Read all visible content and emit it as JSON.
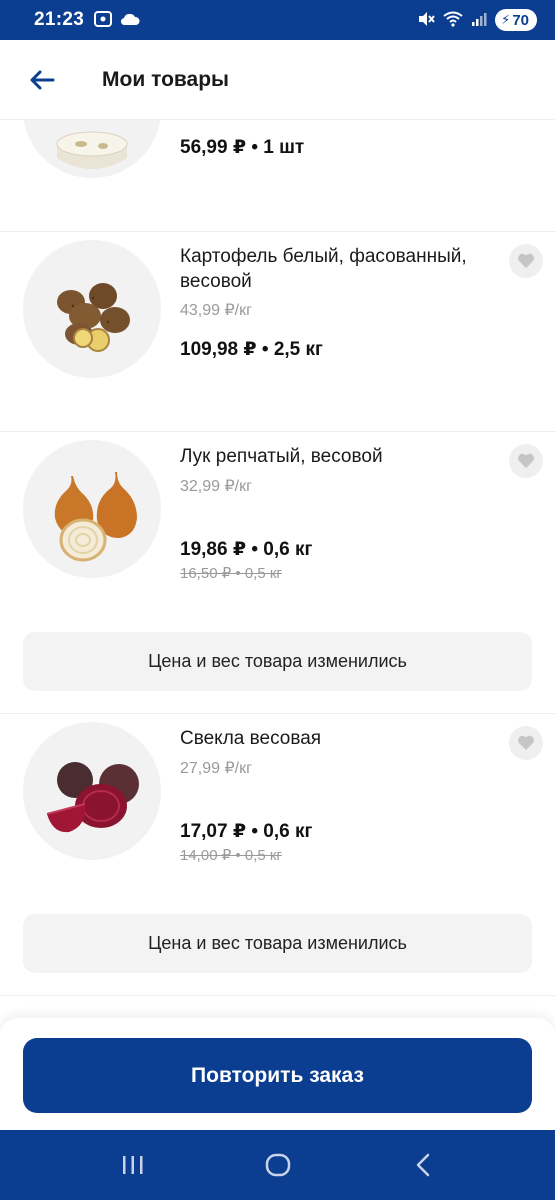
{
  "status_bar": {
    "time": "21:23",
    "battery": "70",
    "icons": [
      "screenshot-icon",
      "cloud-icon",
      "mute-icon",
      "wifi-icon",
      "signal-icon",
      "battery-icon"
    ]
  },
  "header": {
    "title": "Мои товары",
    "back_icon": "arrow-left-icon"
  },
  "products": [
    {
      "name": "",
      "unit_price": "",
      "total": "56,99 ₽ • 1 шт",
      "old": ""
    },
    {
      "name": "Картофель белый, фасованный, весовой",
      "unit_price": "43,99 ₽/кг",
      "total": "109,98 ₽ • 2,5 кг",
      "old": ""
    },
    {
      "name": "Лук репчатый, весовой",
      "unit_price": "32,99 ₽/кг",
      "total": "19,86 ₽ • 0,6 кг",
      "old": "16,50 ₽ • 0,5 кг",
      "notice": "Цена и вес товара изменились"
    },
    {
      "name": "Свекла весовая",
      "unit_price": "27,99 ₽/кг",
      "total": "17,07 ₽ • 0,6 кг",
      "old": "14,00 ₽ • 0,5 кг",
      "notice": "Цена и вес товара изменились"
    }
  ],
  "action": {
    "repeat_label": "Повторить заказ"
  },
  "colors": {
    "brand": "#0b3d91",
    "muted_text": "#9a9a9a",
    "card_bg": "#f3f3f3"
  }
}
